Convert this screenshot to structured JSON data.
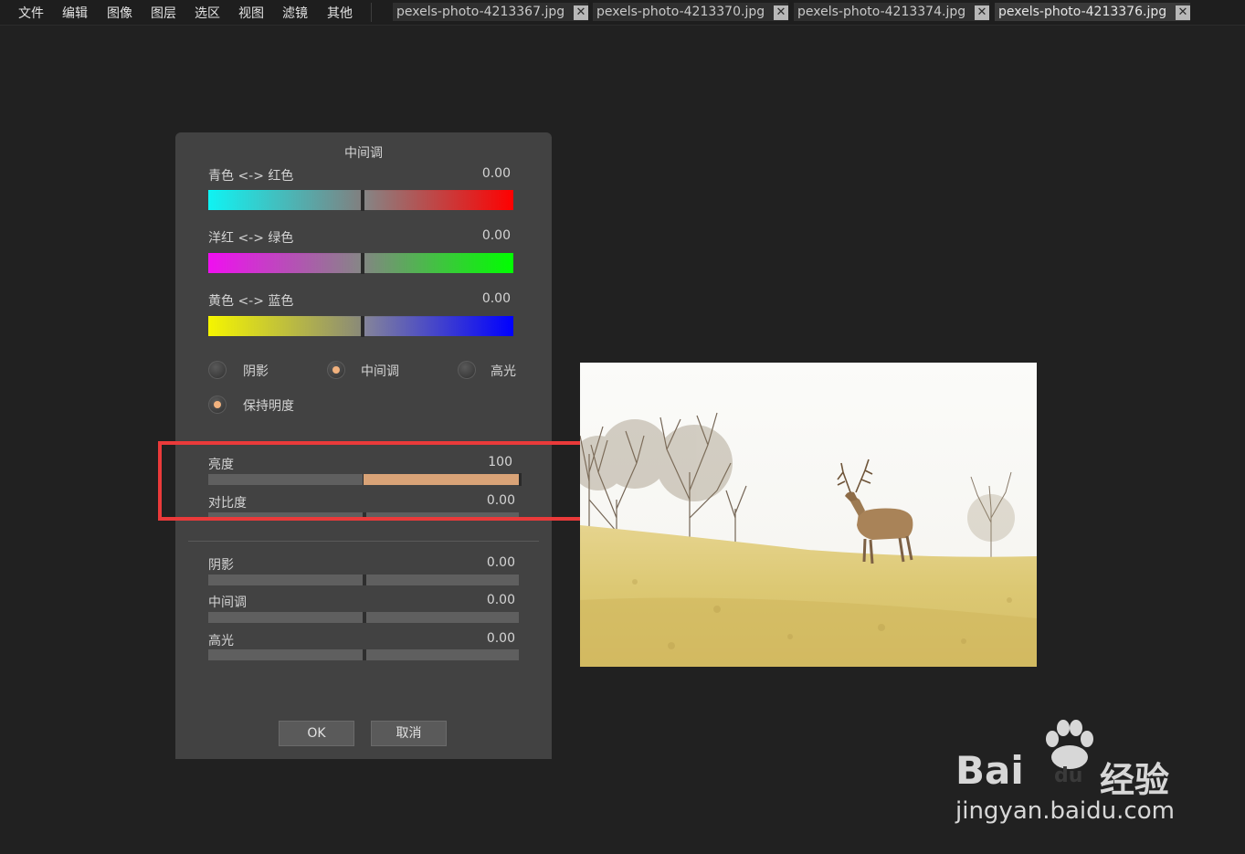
{
  "menu": [
    "文件",
    "编辑",
    "图像",
    "图层",
    "选区",
    "视图",
    "滤镜",
    "其他"
  ],
  "tabs": [
    {
      "label": "pexels-photo-4213367.jpg"
    },
    {
      "label": "pexels-photo-4213370.jpg"
    },
    {
      "label": "pexels-photo-4213374.jpg"
    },
    {
      "label": "pexels-photo-4213376.jpg",
      "active": true
    }
  ],
  "tab_close_glyph": "✕",
  "dialog": {
    "title": "中间调",
    "color_sliders": [
      {
        "label": "青色 <-> 红色",
        "value": "0.00",
        "left_color": "#00ffff",
        "right_color": "#ff0000"
      },
      {
        "label": "洋红 <-> 绿色",
        "value": "0.00",
        "left_color": "#ff00ff",
        "right_color": "#00ff00"
      },
      {
        "label": "黄色 <-> 蓝色",
        "value": "0.00",
        "left_color": "#ffff00",
        "right_color": "#0000ff"
      }
    ],
    "tone_options": [
      {
        "label": "阴影",
        "selected": false
      },
      {
        "label": "中间调",
        "selected": true
      },
      {
        "label": "高光",
        "selected": false
      }
    ],
    "preserve_luminosity": {
      "label": "保持明度",
      "checked": true
    },
    "brightness": {
      "label": "亮度",
      "value": "100",
      "fraction": 1.0
    },
    "contrast": {
      "label": "对比度",
      "value": "0.00",
      "fraction": 0.0
    },
    "levels": [
      {
        "label": "阴影",
        "value": "0.00"
      },
      {
        "label": "中间调",
        "value": "0.00"
      },
      {
        "label": "高光",
        "value": "0.00"
      }
    ],
    "ok_label": "OK",
    "cancel_label": "取消"
  },
  "accent_color": "#d9a377",
  "highlight_color": "#ea3a3a",
  "watermark": {
    "brand": "Bai",
    "paw": "du",
    "cn": "经验",
    "url": "jingyan.baidu.com"
  }
}
